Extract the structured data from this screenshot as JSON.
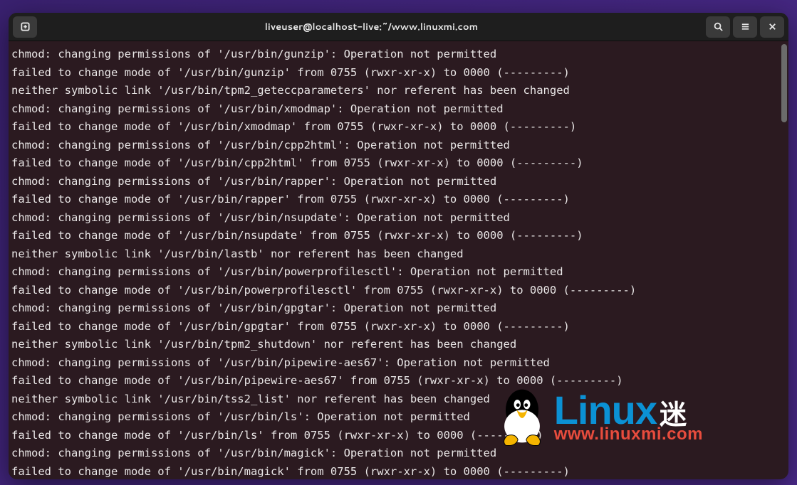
{
  "titlebar": {
    "title": "liveuser@localhost-live:~/www.linuxmi.com"
  },
  "terminal_lines": [
    "chmod: changing permissions of '/usr/bin/gunzip': Operation not permitted",
    "failed to change mode of '/usr/bin/gunzip' from 0755 (rwxr-xr-x) to 0000 (---------)",
    "neither symbolic link '/usr/bin/tpm2_geteccparameters' nor referent has been changed",
    "chmod: changing permissions of '/usr/bin/xmodmap': Operation not permitted",
    "failed to change mode of '/usr/bin/xmodmap' from 0755 (rwxr-xr-x) to 0000 (---------)",
    "chmod: changing permissions of '/usr/bin/cpp2html': Operation not permitted",
    "failed to change mode of '/usr/bin/cpp2html' from 0755 (rwxr-xr-x) to 0000 (---------)",
    "chmod: changing permissions of '/usr/bin/rapper': Operation not permitted",
    "failed to change mode of '/usr/bin/rapper' from 0755 (rwxr-xr-x) to 0000 (---------)",
    "chmod: changing permissions of '/usr/bin/nsupdate': Operation not permitted",
    "failed to change mode of '/usr/bin/nsupdate' from 0755 (rwxr-xr-x) to 0000 (---------)",
    "neither symbolic link '/usr/bin/lastb' nor referent has been changed",
    "chmod: changing permissions of '/usr/bin/powerprofilesctl': Operation not permitted",
    "failed to change mode of '/usr/bin/powerprofilesctl' from 0755 (rwxr-xr-x) to 0000 (---------)",
    "chmod: changing permissions of '/usr/bin/gpgtar': Operation not permitted",
    "failed to change mode of '/usr/bin/gpgtar' from 0755 (rwxr-xr-x) to 0000 (---------)",
    "neither symbolic link '/usr/bin/tpm2_shutdown' nor referent has been changed",
    "chmod: changing permissions of '/usr/bin/pipewire-aes67': Operation not permitted",
    "failed to change mode of '/usr/bin/pipewire-aes67' from 0755 (rwxr-xr-x) to 0000 (---------)",
    "neither symbolic link '/usr/bin/tss2_list' nor referent has been changed",
    "chmod: changing permissions of '/usr/bin/ls': Operation not permitted",
    "failed to change mode of '/usr/bin/ls' from 0755 (rwxr-xr-x) to 0000 (---------)",
    "chmod: changing permissions of '/usr/bin/magick': Operation not permitted",
    "failed to change mode of '/usr/bin/magick' from 0755 (rwxr-xr-x) to 0000 (---------)"
  ],
  "watermark": {
    "brand": "Linux",
    "brand_cn": "迷",
    "url": "www.linuxmi.com"
  },
  "colors": {
    "window_bg": "#2b1a20",
    "titlebar_bg": "#1e1e1e",
    "text": "#e9e6e6",
    "brand_blue": "#0b91d4",
    "brand_red": "#e84c3d"
  }
}
